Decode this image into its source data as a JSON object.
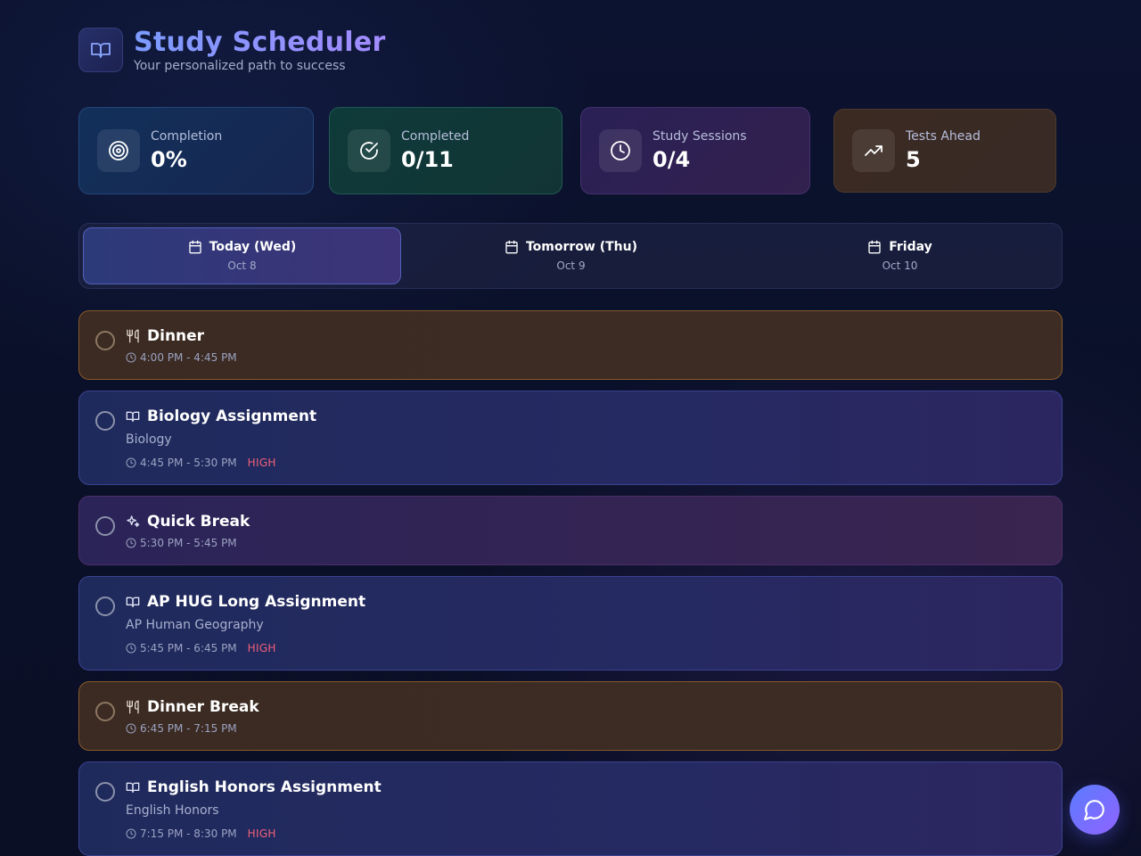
{
  "header": {
    "title": "Study Scheduler",
    "subtitle": "Your personalized path to success",
    "logo_icon": "book-icon"
  },
  "stats": [
    {
      "label": "Completion",
      "value": "0%",
      "icon": "target-icon"
    },
    {
      "label": "Completed",
      "value": "0/11",
      "icon": "check-circle-icon"
    },
    {
      "label": "Study Sessions",
      "value": "0/4",
      "icon": "clock-icon"
    },
    {
      "label": "Tests Ahead",
      "value": "5",
      "icon": "trending-up-icon"
    }
  ],
  "tabs": [
    {
      "label": "Today (Wed)",
      "date": "Oct 8",
      "active": true
    },
    {
      "label": "Tomorrow (Thu)",
      "date": "Oct 9",
      "active": false
    },
    {
      "label": "Friday",
      "date": "Oct 10",
      "active": false
    }
  ],
  "tasks": [
    {
      "title": "Dinner",
      "time": "4:00 PM - 4:45 PM",
      "type": "meal",
      "icon": "utensils-icon"
    },
    {
      "title": "Biology Assignment",
      "subject": "Biology",
      "time": "4:45 PM - 5:30 PM",
      "priority": "HIGH",
      "type": "study",
      "icon": "book-icon"
    },
    {
      "title": "Quick Break",
      "time": "5:30 PM - 5:45 PM",
      "type": "break",
      "icon": "sparkles-icon"
    },
    {
      "title": "AP HUG Long Assignment",
      "subject": "AP Human Geography",
      "time": "5:45 PM - 6:45 PM",
      "priority": "HIGH",
      "type": "study",
      "icon": "book-icon"
    },
    {
      "title": "Dinner Break",
      "time": "6:45 PM - 7:15 PM",
      "type": "meal",
      "icon": "utensils-icon"
    },
    {
      "title": "English Honors Assignment",
      "subject": "English Honors",
      "time": "7:15 PM - 8:30 PM",
      "priority": "HIGH",
      "type": "study",
      "icon": "book-icon"
    }
  ],
  "colors": {
    "accent": "#7b9bff",
    "priority_high": "#f0607a",
    "chat_button": "#6f70ff"
  }
}
